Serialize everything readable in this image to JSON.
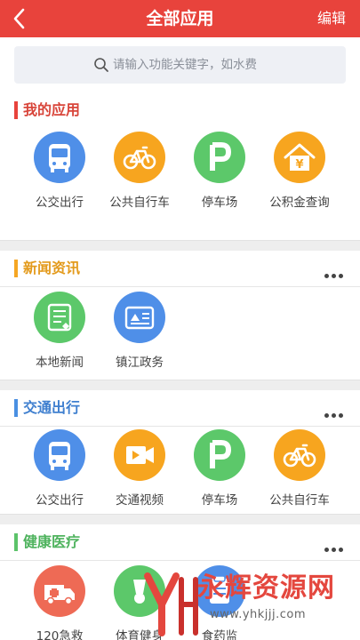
{
  "header": {
    "title": "全部应用",
    "edit_label": "编辑"
  },
  "search": {
    "placeholder": "请输入功能关键字，如水费"
  },
  "colors": {
    "brand_red": "#e8433c",
    "bar_red": "#e8433c",
    "bar_orange": "#f5a623",
    "bar_blue": "#4a90e2",
    "bar_green": "#5cc36a",
    "icon_blue": "#4f8fe8",
    "icon_orange": "#f7a51f",
    "icon_green": "#5cc86a",
    "icon_red": "#ee6a55"
  },
  "sections": [
    {
      "title": "我的应用",
      "items": [
        {
          "label": "公交出行",
          "icon": "bus-icon"
        },
        {
          "label": "公共自行车",
          "icon": "bicycle-icon"
        },
        {
          "label": "停车场",
          "icon": "parking-icon"
        },
        {
          "label": "公积金查询",
          "icon": "housing-fund-icon"
        }
      ]
    },
    {
      "title": "新闻资讯",
      "items": [
        {
          "label": "本地新闻",
          "icon": "news-icon"
        },
        {
          "label": "镇江政务",
          "icon": "government-icon"
        }
      ]
    },
    {
      "title": "交通出行",
      "items": [
        {
          "label": "公交出行",
          "icon": "bus-icon"
        },
        {
          "label": "交通视频",
          "icon": "video-icon"
        },
        {
          "label": "停车场",
          "icon": "parking-icon"
        },
        {
          "label": "公共自行车",
          "icon": "bicycle-icon"
        }
      ]
    },
    {
      "title": "健康医疗",
      "items": [
        {
          "label": "120急救",
          "icon": "ambulance-icon"
        },
        {
          "label": "体育健身",
          "icon": "badminton-icon"
        },
        {
          "label": "食药监",
          "icon": "food-drug-icon"
        }
      ]
    }
  ],
  "watermark": {
    "brand": "永辉资源网",
    "url": "www.yhkjjj.com"
  }
}
